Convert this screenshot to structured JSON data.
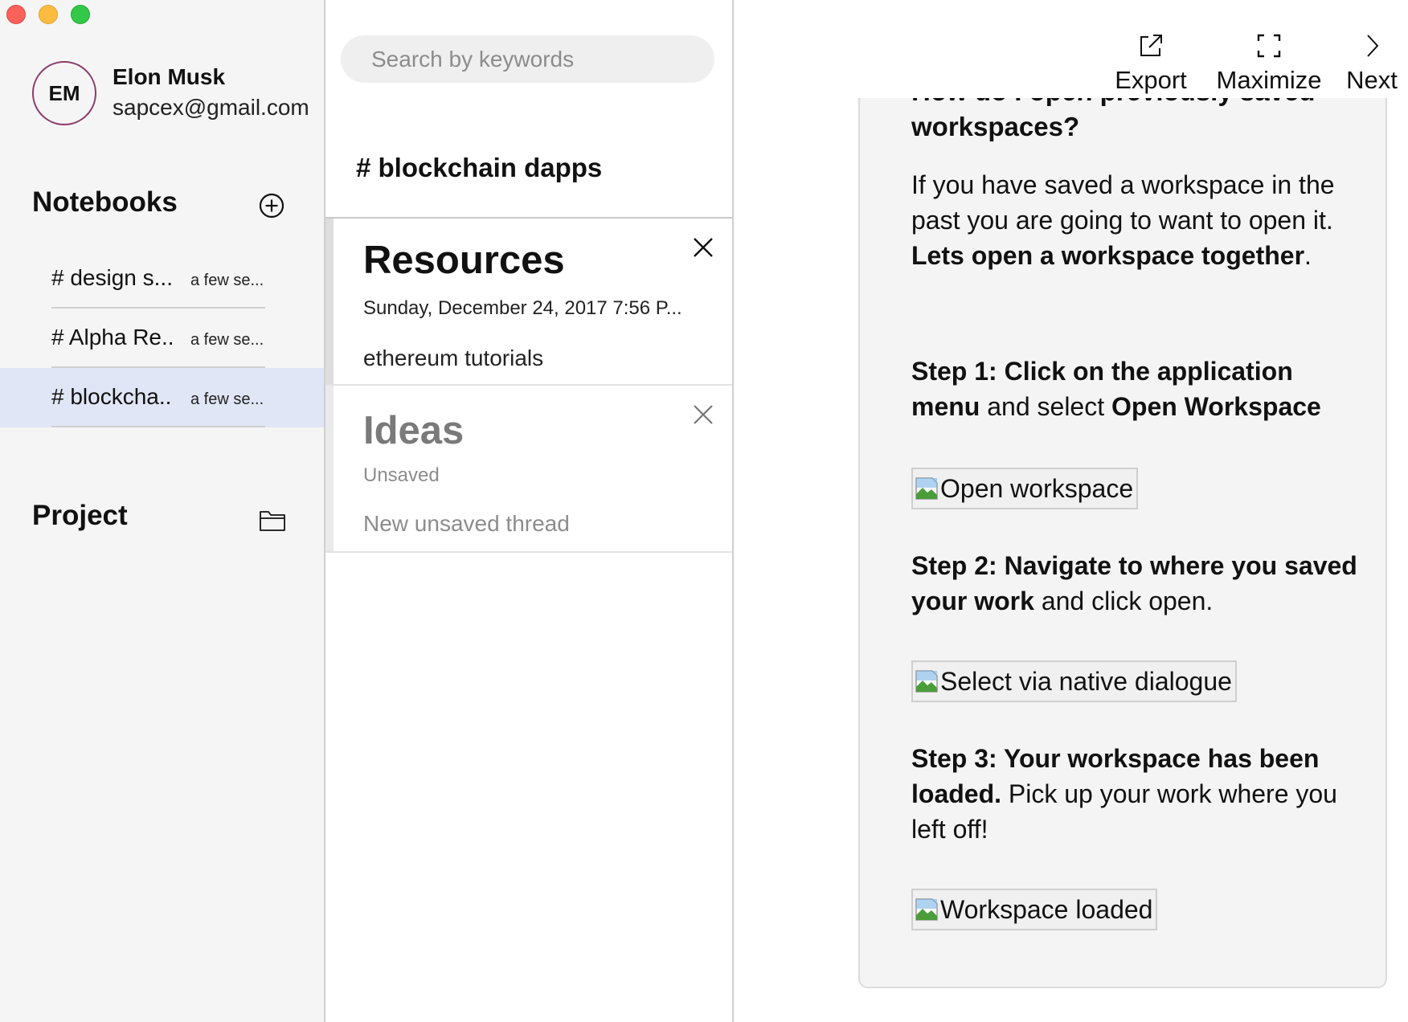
{
  "sidebar": {
    "user": {
      "initials": "EM",
      "name": "Elon Musk",
      "email": "sapcex@gmail.com"
    },
    "notebooks_title": "Notebooks",
    "notebooks": [
      {
        "name": "# design s...",
        "time": "a few se...",
        "active": false
      },
      {
        "name": "# Alpha Re..",
        "time": "a few se...",
        "active": false
      },
      {
        "name": "# blockcha..",
        "time": "a few se...",
        "active": true
      }
    ],
    "project_title": "Project"
  },
  "threads": {
    "search_placeholder": "Search by keywords",
    "notebook_heading": "# blockchain dapps",
    "items": [
      {
        "title": "Resources",
        "date": "Sunday, December 24, 2017 7:56 P...",
        "subtitle": "ethereum tutorials"
      },
      {
        "title": "Ideas",
        "date": "Unsaved",
        "subtitle": "New unsaved thread"
      }
    ]
  },
  "toolbar": {
    "export": "Export",
    "maximize": "Maximize",
    "next": "Next"
  },
  "content": {
    "heading_top": "How do I open previously saved",
    "heading_bottom": "workspaces?",
    "intro": "If you have saved a workspace in the past you are going to want to open it.",
    "intro_bold": "Lets open a workspace together",
    "intro_end": ".",
    "step1_bold": "Step 1: Click on the application menu",
    "step1_text": " and select ",
    "step1_bold2": "Open Workspace",
    "img1_alt": "Open workspace",
    "step2_bold": "Step 2: Navigate to where you saved your work",
    "step2_text": " and click open.",
    "img2_alt": "Select via native dialogue",
    "step3_bold": "Step 3: Your workspace has been loaded.",
    "step3_text": " Pick up your work where you left off!",
    "img3_alt": "Workspace loaded"
  },
  "colors": {
    "sidebar_bg": "#f5f5f5",
    "active_item": "#e0e6f5",
    "avatar_ring": "#8a3a6c",
    "content_bg": "#f4f4f4"
  }
}
